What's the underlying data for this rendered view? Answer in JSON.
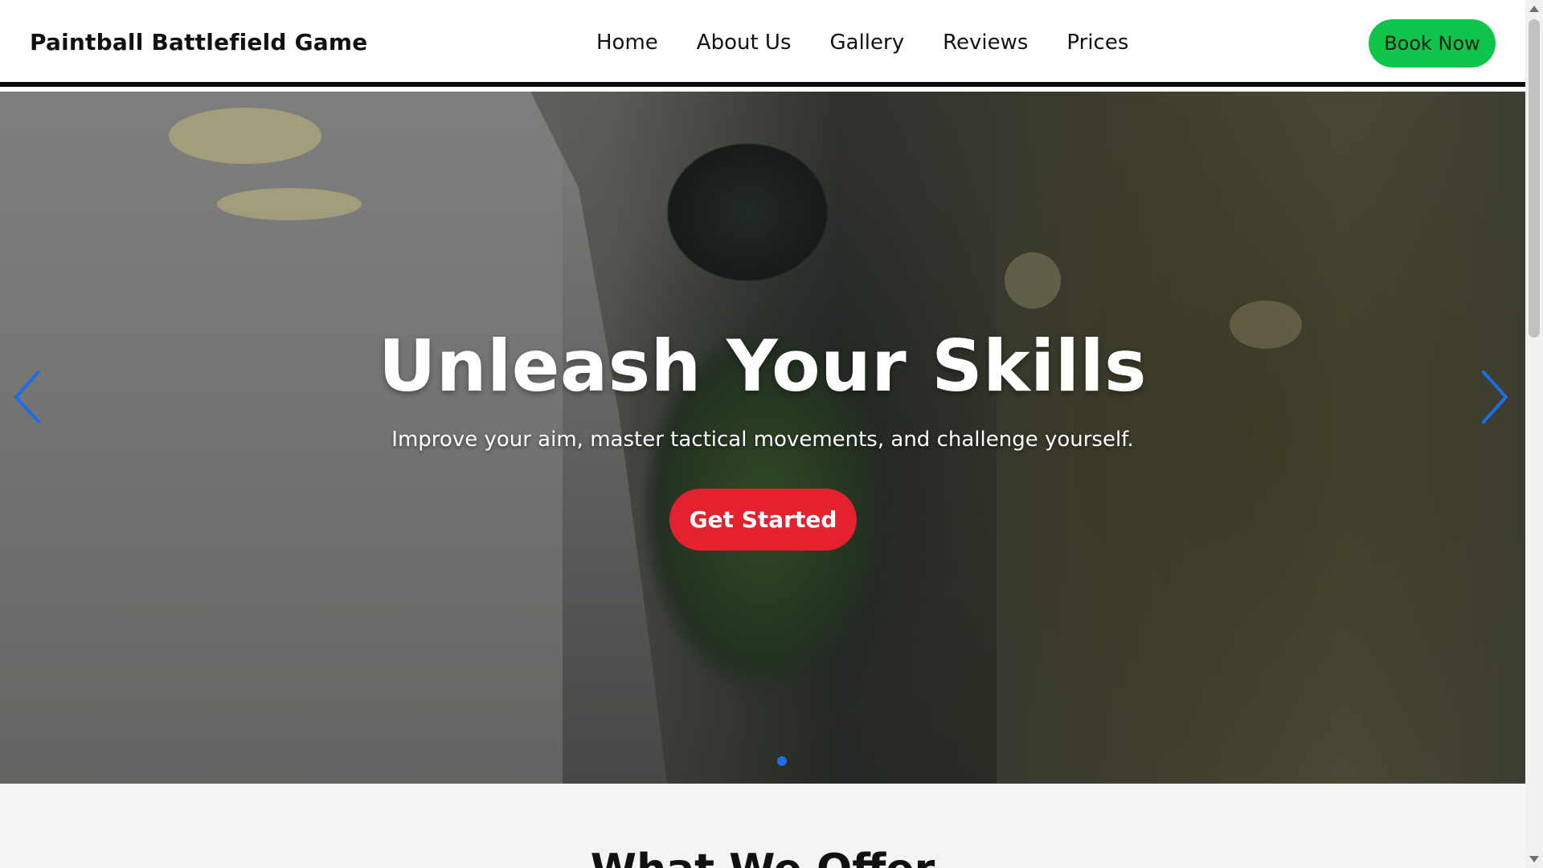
{
  "header": {
    "brand": "Paintball Battlefield Game",
    "nav": [
      "Home",
      "About Us",
      "Gallery",
      "Reviews",
      "Prices"
    ],
    "book_label": "Book Now"
  },
  "hero": {
    "title": "Unleash Your Skills",
    "subtitle": "Improve your aim, master tactical movements, and challenge yourself.",
    "cta_label": "Get Started",
    "prev_icon": "chevron-left-icon",
    "next_icon": "chevron-right-icon",
    "slide_indicator": {
      "current": 1
    }
  },
  "offer": {
    "title": "What We Offer"
  },
  "colors": {
    "book_button": "#0fc44a",
    "cta_button": "#e3212f",
    "arrow": "#1a6fe8",
    "dot_active": "#1a6fe8",
    "section_bg": "#f3f4f6"
  }
}
